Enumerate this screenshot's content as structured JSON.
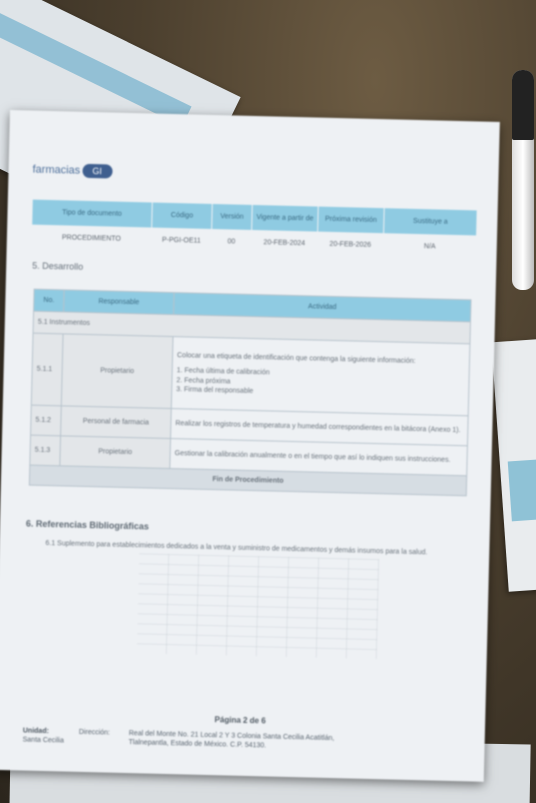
{
  "document": {
    "logo_text": "farmacias",
    "logo_mark": "GI",
    "header_table": {
      "columns": [
        "Tipo de documento",
        "Código",
        "Versión",
        "Vigente a partir de",
        "Próxima revisión",
        "Sustituye a"
      ],
      "row": [
        "PROCEDIMIENTO",
        "P-PGI-OE11",
        "00",
        "20-FEB-2024",
        "20-FEB-2026",
        "N/A"
      ]
    },
    "section_title": "5. Desarrollo",
    "activity_table": {
      "col_no": "No.",
      "col_responsible": "Responsable",
      "col_activity": "Actividad",
      "subsection": "5.1 Instrumentos",
      "rows": [
        {
          "no": "5.1.1",
          "responsible": "Propietario",
          "activity": "Colocar una etiqueta de identificación que contenga la siguiente información:",
          "items": [
            "1. Fecha última de calibración",
            "2. Fecha próxima",
            "3. Firma del responsable"
          ]
        },
        {
          "no": "5.1.2",
          "responsible": "Personal de farmacia",
          "activity": "Realizar los registros de temperatura y humedad correspondientes en la bitácora (Anexo 1)."
        },
        {
          "no": "5.1.3",
          "responsible": "Propietario",
          "activity": "Gestionar la calibración anualmente o en el tiempo que así lo indiquen sus instrucciones."
        }
      ],
      "end_label": "Fin de Procedimiento"
    },
    "references_title": "6. Referencias Bibliográficas",
    "references_text": "6.1 Suplemento para establecimientos dedicados a la venta y suministro de medicamentos y demás insumos para la salud.",
    "page_number": "Página 2 de 6",
    "footer": {
      "unit_label": "Unidad:",
      "unit_value": "Santa Cecilia",
      "address_label": "Dirección:",
      "address_line1": "Real del Monte No. 21 Local 2 Y 3 Colonia Santa Cecilia Acatitlán,",
      "address_line2": "Tlalnepantla, Estado de México. C.P. 54130."
    }
  }
}
